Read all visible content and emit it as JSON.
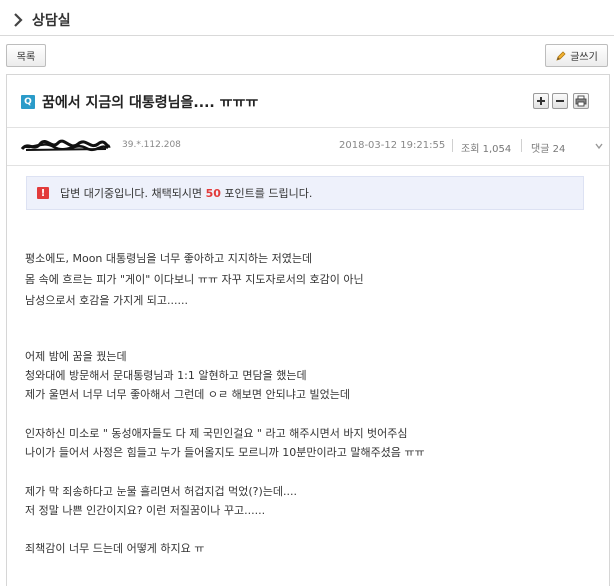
{
  "breadcrumb": {
    "title": "상담실"
  },
  "toolbar": {
    "list_label": "목록",
    "write_label": "글쓰기"
  },
  "post": {
    "badge": "Q",
    "title": "꿈에서 지금의 대통령님을.... ㅠㅠㅠ",
    "ip": "39.*.112.208",
    "date": "2018-03-12 19:21:55",
    "views": "조회 1,054",
    "comments": "댓글 24"
  },
  "notice": {
    "prefix": "답변 대기중입니다. 채택되시면",
    "points": "50",
    "suffix": "포인트를 드립니다."
  },
  "body": [
    "평소에도, Moon 대통령님을 너무 좋아하고 지지하는 저였는데",
    "몸 속에 흐르는 피가 \"게이\" 이다보니 ㅠㅠ 자꾸 지도자로서의 호감이 아닌",
    "남성으로서 호감을 가지게 되고......",
    "어제 밤에 꿈을 꿨는데",
    "청와대에 방문해서 문대통령님과 1:1 알현하고 면담을 했는데",
    "제가 울면서 너무 너무 좋아해서 그런데 ㅇㄹ 해보면 안되냐고 빌었는데",
    "인자하신 미소로 \" 동성애자들도 다 제 국민인걸요 \" 라고 해주시면서 바지 벗어주심",
    "나이가 들어서 사정은 힘들고 누가 들어올지도 모르니까 10분만이라고 말해주셨음 ㅠㅠ",
    "제가 막 죄송하다고 눈물 흘리면서 허겁지겁 먹었(?)는데....",
    "저 정말 나쁜 인간이지요? 이런 저질꿈이나 꾸고......",
    "죄책감이 너무 드는데 어떻게 하지요 ㅠ"
  ],
  "colors": {
    "badge": "#2a9bc9",
    "alert": "#e23b3b",
    "notice_bg": "#eef1fb"
  },
  "icons": [
    "chevron-right-icon",
    "pencil-icon",
    "plus-icon",
    "minus-icon",
    "print-icon",
    "exclamation-icon",
    "chevron-down-icon"
  ]
}
